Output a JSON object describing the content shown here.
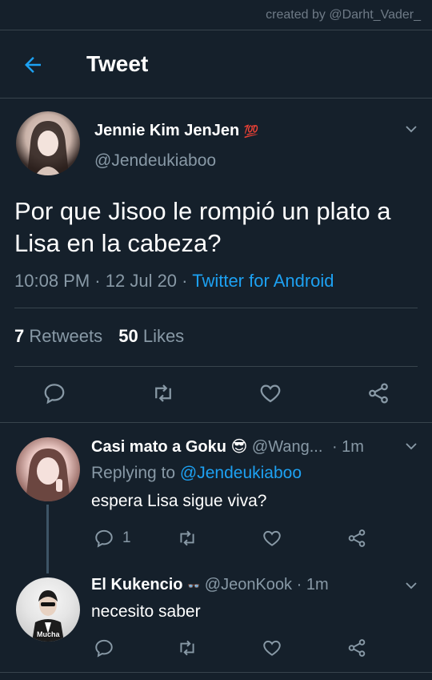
{
  "watermark": "created by @Darht_Vader_",
  "header": {
    "title": "Tweet"
  },
  "main_tweet": {
    "name": "Jennie Kim JenJen",
    "name_emoji": "💯",
    "handle": "@Jendeukiaboo",
    "text_line1": "Por que Jisoo le rompió un plato a",
    "text_line2": "Lisa en la cabeza?",
    "time": "10:08 PM",
    "sep1": "·",
    "date": "12 Jul 20",
    "sep2": "·",
    "source": "Twitter for Android",
    "retweets_count": "7",
    "retweets_label": "Retweets",
    "likes_count": "50",
    "likes_label": "Likes"
  },
  "replies": [
    {
      "name": "Casi mato a Goku",
      "name_emoji": "😎",
      "handle": "@Wang...",
      "time": "· 1m",
      "replying_label": "Replying to",
      "replying_handle": "@Jendeukiaboo",
      "text": "espera Lisa sigue viva?",
      "reply_count": "1"
    },
    {
      "name": "El Kukencio",
      "name_emoji": "👓",
      "handle": "@JeonKook",
      "time": "· 1m",
      "text": "necesito saber",
      "avatar_caption": "Mucha"
    }
  ],
  "colors": {
    "background": "#15202b",
    "divider": "#38444d",
    "accent": "#1da1f2",
    "secondary_text": "#8899a6",
    "primary_text": "#ffffff"
  }
}
